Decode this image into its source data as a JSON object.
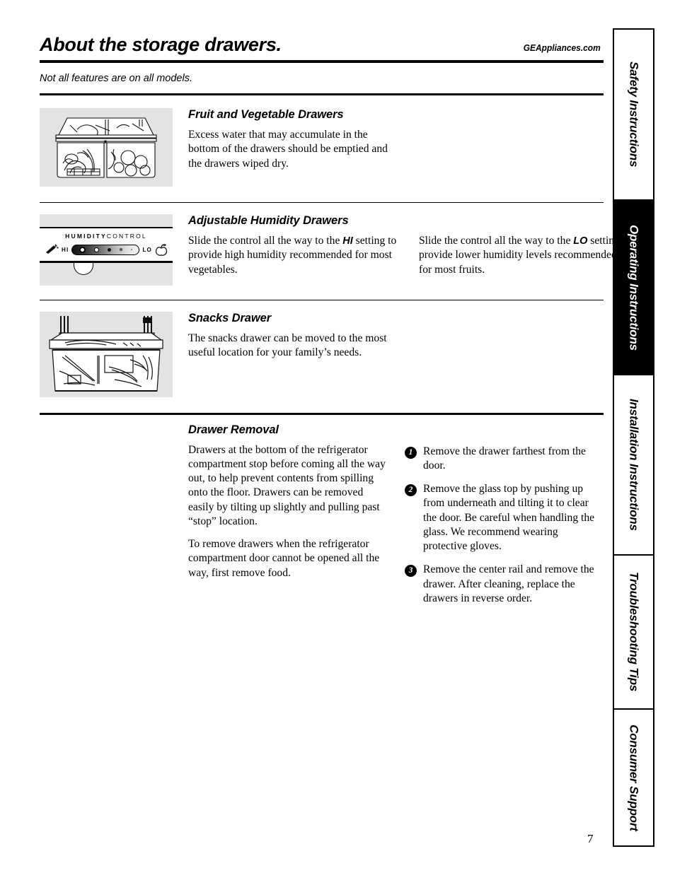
{
  "header": {
    "title": "About the storage drawers.",
    "site_url": "GEAppliances.com",
    "note": "Not all features are on all models."
  },
  "sections": [
    {
      "heading": "Fruit and Vegetable Drawers",
      "figure": "fruit-and-vegetable-drawers-illustration",
      "body": "Excess water that may accumulate in the bottom of the drawers should be emptied and the drawers wiped dry."
    },
    {
      "heading": "Adjustable Humidity Drawers",
      "figure": "humidity-control-panel-illustration",
      "body_left_1": "Slide the control all the way to the ",
      "body_left_bold": "HI",
      "body_left_2": " setting to provide high humidity recommended for most vegetables.",
      "body_right_1": "Slide the control all the way to the ",
      "body_right_bold": "LO",
      "body_right_2": " setting to provide lower humidity levels recommended for most fruits."
    },
    {
      "heading": "Snacks Drawer",
      "figure": "snacks-drawer-illustration",
      "body": "The snacks drawer can be moved to the most useful location for your family’s needs."
    }
  ],
  "humidity_control": {
    "label_bold": "HUMIDITY",
    "label_light": "CONTROL",
    "hi_label": "HI",
    "lo_label": "LO",
    "left_icon": "carrot-icon",
    "right_icon": "apple-icon"
  },
  "drawer_removal": {
    "heading": "Drawer Removal",
    "paragraph_1": "Drawers at the bottom of the refrigerator compartment stop before coming all the way out, to help prevent contents from spilling onto the floor. Drawers can be removed easily by tilting up slightly and pulling past “stop” location.",
    "paragraph_2": "To remove drawers when the refrigerator compartment door cannot be opened all the way, first remove food.",
    "steps": [
      {
        "num": "1",
        "text": "Remove the drawer farthest from the door."
      },
      {
        "num": "2",
        "text": "Remove the glass top by pushing up from underneath and tilting it to clear the door. Be careful when handling the glass. We recommend wearing protective gloves."
      },
      {
        "num": "3",
        "text": "Remove the center rail and remove the drawer. After cleaning, replace the drawers in reverse order."
      }
    ]
  },
  "sidebar": {
    "tabs": [
      {
        "label": "Safety Instructions",
        "active": false
      },
      {
        "label": "Operating Instructions",
        "active": true
      },
      {
        "label": "Installation Instructions",
        "active": false
      },
      {
        "label": "Troubleshooting Tips",
        "active": false
      },
      {
        "label": "Consumer Support",
        "active": false
      }
    ]
  },
  "page_number": "7",
  "colors": {
    "figure_background": "#e3e3e3",
    "rule": "#000000",
    "active_tab_background": "#000000",
    "active_tab_text": "#ffffff"
  }
}
